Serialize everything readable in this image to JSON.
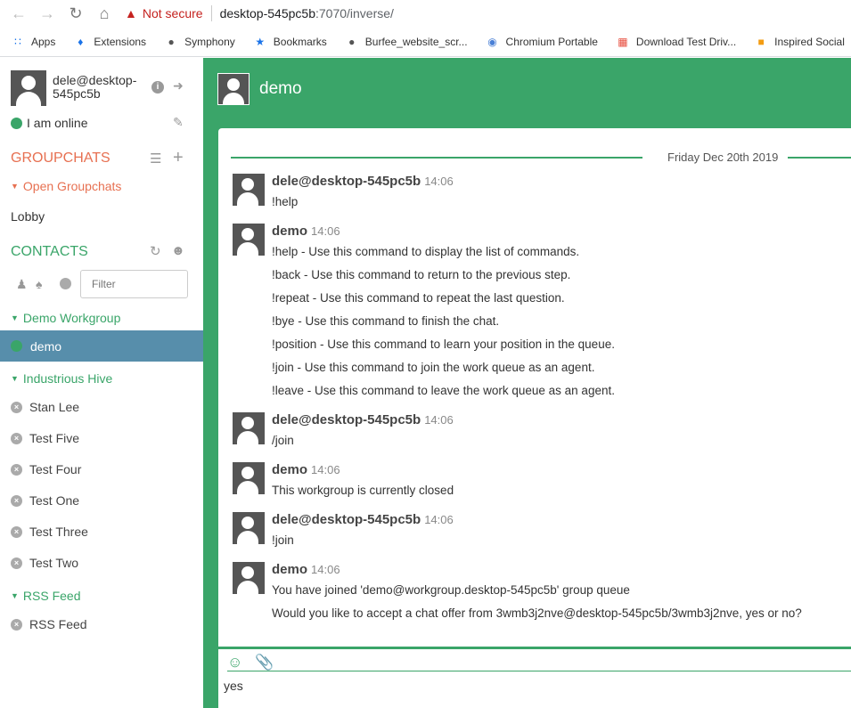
{
  "browser": {
    "security_text": "Not secure",
    "url_host": "desktop-545pc5b",
    "url_rest": ":7070/inverse/",
    "bookmarks": [
      {
        "label": "Apps",
        "icon": "apps-grid-icon"
      },
      {
        "label": "Extensions",
        "icon": "puzzle-icon"
      },
      {
        "label": "Symphony",
        "icon": "globe-icon"
      },
      {
        "label": "Bookmarks",
        "icon": "star-icon"
      },
      {
        "label": "Burfee_website_scr...",
        "icon": "globe-icon"
      },
      {
        "label": "Chromium Portable",
        "icon": "chromium-icon"
      },
      {
        "label": "Download Test Driv...",
        "icon": "windows-icon"
      },
      {
        "label": "Inspired Social",
        "icon": "inspired-icon"
      }
    ]
  },
  "sidebar": {
    "profile_name": "dele@desktop-545pc5b",
    "status_text": "I am online",
    "groupchats_title": "GROUPCHATS",
    "open_groupchats_label": "Open Groupchats",
    "lobby_label": "Lobby",
    "contacts_title": "CONTACTS",
    "filter_placeholder": "Filter",
    "groups": {
      "demo_workgroup": "Demo Workgroup",
      "industrious_hive": "Industrious Hive",
      "rss_feed": "RSS Feed"
    },
    "active_contact": "demo",
    "hive_contacts": [
      "Stan Lee",
      "Test Five",
      "Test Four",
      "Test One",
      "Test Three",
      "Test Two"
    ],
    "rss_contact": "RSS Feed"
  },
  "chat": {
    "title": "demo",
    "day_label": "Friday Dec 20th 2019",
    "messages": [
      {
        "author": "dele@desktop-545pc5b",
        "time": "14:06",
        "lines": [
          "!help"
        ]
      },
      {
        "author": "demo",
        "time": "14:06",
        "lines": [
          "!help - Use this command to display the list of commands.",
          "!back - Use this command to return to the previous step.",
          "!repeat - Use this command to repeat the last question.",
          "!bye - Use this command to finish the chat.",
          "!position - Use this command to learn your position in the queue.",
          "!join - Use this command to join the work queue as an agent.",
          "!leave - Use this command to leave the work queue as an agent."
        ]
      },
      {
        "author": "dele@desktop-545pc5b",
        "time": "14:06",
        "lines": [
          "/join"
        ]
      },
      {
        "author": "demo",
        "time": "14:06",
        "lines": [
          "This workgroup is currently closed"
        ]
      },
      {
        "author": "dele@desktop-545pc5b",
        "time": "14:06",
        "lines": [
          "!join"
        ]
      },
      {
        "author": "demo",
        "time": "14:06",
        "lines": [
          "You have joined 'demo@workgroup.desktop-545pc5b' group queue",
          "Would you like to accept a chat offer from 3wmb3j2nve@desktop-545pc5b/3wmb3j2nve, yes or no?"
        ]
      }
    ],
    "composer_text": "yes"
  },
  "colors": {
    "brand_green": "#3aa569",
    "accent_red": "#e77051",
    "active_blue": "#578eab"
  }
}
